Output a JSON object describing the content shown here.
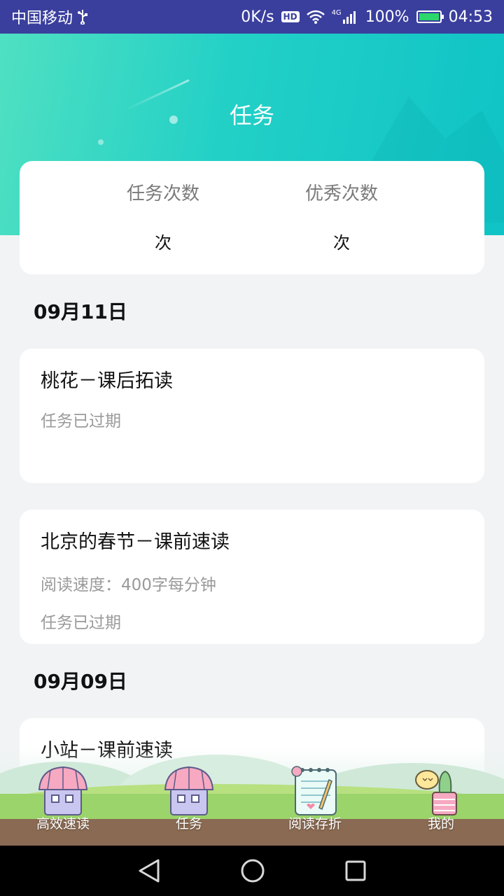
{
  "status_bar": {
    "carrier": "中国移动",
    "usb_icon": "usb-icon",
    "net_speed": "0K/s",
    "hd_badge": "HD",
    "network_type": "4G",
    "battery_percent": "100%",
    "time": "04:53",
    "bg_color": "#3a3f9e"
  },
  "header": {
    "title": "任务",
    "gradient_start": "#4fe0c2",
    "gradient_end": "#0fc3c6"
  },
  "stats": {
    "task_count_label": "任务次数",
    "task_count_value": "次",
    "excellent_count_label": "优秀次数",
    "excellent_count_value": "次"
  },
  "sections": [
    {
      "date": "09月11日",
      "tasks": [
        {
          "title": "桃花－课后拓读",
          "lines": [
            "任务已过期"
          ]
        },
        {
          "title": "北京的春节－课前速读",
          "lines": [
            "阅读速度：400字每分钟",
            "任务已过期"
          ]
        }
      ]
    },
    {
      "date": "09月09日",
      "tasks": [
        {
          "title": "小站－课前速读",
          "lines": []
        }
      ]
    }
  ],
  "bottom_tabs": [
    {
      "label": "高效速读",
      "icon": "house-icon"
    },
    {
      "label": "任务",
      "icon": "house-icon"
    },
    {
      "label": "阅读存折",
      "icon": "notebook-icon"
    },
    {
      "label": "我的",
      "icon": "cactus-icon"
    }
  ],
  "system_nav": {
    "back_icon": "back-triangle-icon",
    "home_icon": "home-circle-icon",
    "recents_icon": "recents-square-icon"
  }
}
